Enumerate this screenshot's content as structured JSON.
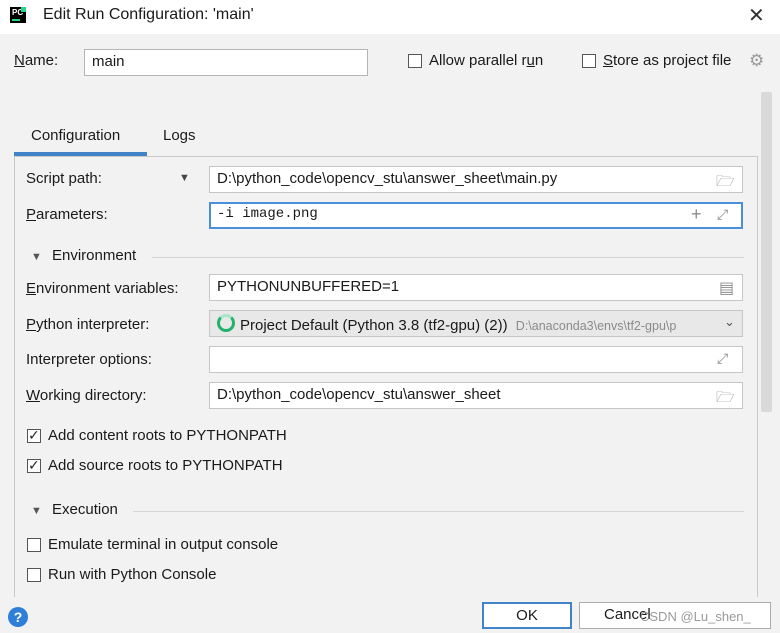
{
  "window": {
    "title": "Edit Run Configuration: 'main'",
    "app_icon_text": "PC"
  },
  "name_row": {
    "label": "Name:",
    "value": "main",
    "allow_parallel_label": "Allow parallel run",
    "allow_parallel_checked": false,
    "store_label": "Store as project file",
    "store_checked": false
  },
  "tabs": [
    {
      "label": "Configuration",
      "active": true
    },
    {
      "label": "Logs",
      "active": false
    }
  ],
  "form": {
    "script_path": {
      "label": "Script path:",
      "value": "D:\\python_code\\opencv_stu\\answer_sheet\\main.py"
    },
    "parameters": {
      "label": "Parameters:",
      "value": "-i image.png"
    },
    "environment_section": "Environment",
    "env_vars": {
      "label": "Environment variables:",
      "value": "PYTHONUNBUFFERED=1"
    },
    "interpreter": {
      "label": "Python interpreter:",
      "value": "Project Default (Python 3.8 (tf2-gpu) (2))",
      "path": "D:\\anaconda3\\envs\\tf2-gpu\\p"
    },
    "interpreter_options": {
      "label": "Interpreter options:",
      "value": ""
    },
    "working_dir": {
      "label": "Working directory:",
      "value": "D:\\python_code\\opencv_stu\\answer_sheet"
    },
    "add_content_roots": {
      "label": "Add content roots to PYTHONPATH",
      "checked": true
    },
    "add_source_roots": {
      "label": "Add source roots to PYTHONPATH",
      "checked": true
    },
    "execution_section": "Execution",
    "emulate_terminal": {
      "label": "Emulate terminal in output console",
      "checked": false
    },
    "python_console": {
      "label": "Run with Python Console",
      "checked": false
    }
  },
  "footer": {
    "ok_label": "OK",
    "cancel_label": "Cancel",
    "help_label": "?",
    "watermark": "CSDN @Lu_shen_"
  },
  "colors": {
    "accent": "#4083c9",
    "background": "#f2f2f2",
    "focus_border": "#4a8fd9"
  }
}
